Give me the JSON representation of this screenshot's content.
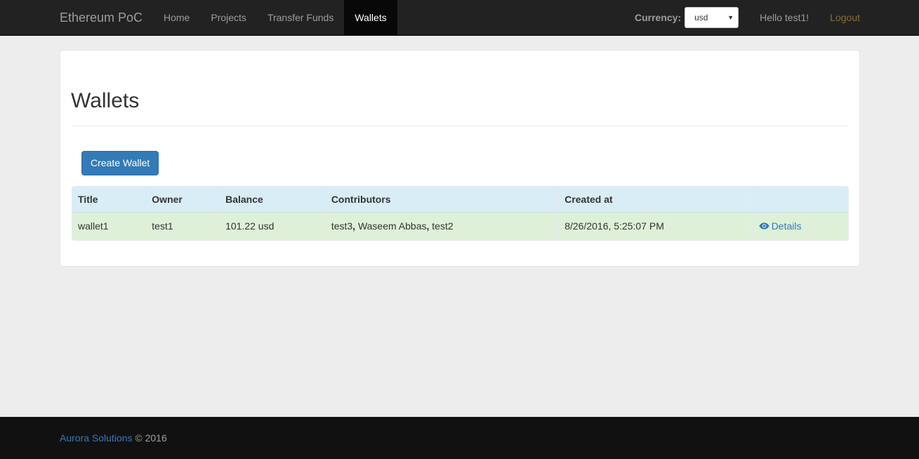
{
  "navbar": {
    "brand": "Ethereum PoC",
    "links": [
      {
        "label": "Home",
        "active": false
      },
      {
        "label": "Projects",
        "active": false
      },
      {
        "label": "Transfer Funds",
        "active": false
      },
      {
        "label": "Wallets",
        "active": true
      }
    ],
    "currency_label": "Currency:",
    "currency_value": "usd",
    "greeting": "Hello test1!",
    "logout_label": "Logout"
  },
  "main": {
    "title": "Wallets",
    "create_button": "Create Wallet",
    "table": {
      "headers": [
        "Title",
        "Owner",
        "Balance",
        "Contributors",
        "Created at",
        ""
      ],
      "rows": [
        {
          "title": "wallet1",
          "owner": "test1",
          "balance": "101.22 usd",
          "contributors": [
            "test3",
            "Waseem Abbas",
            "test2"
          ],
          "created_at": "8/26/2016, 5:25:07 PM",
          "action_label": "Details"
        }
      ]
    }
  },
  "footer": {
    "company": "Aurora Solutions",
    "copyright": "© 2016"
  },
  "colors": {
    "navbar_bg": "#222222",
    "active_nav_bg": "#080808",
    "primary": "#337ab7",
    "header_row": "#d9edf7",
    "success_row": "#dff0d8",
    "logout": "#8a6d3b",
    "footer_bg": "#111111"
  },
  "icons": {
    "details": "eye-icon",
    "select": "caret-down-icon"
  }
}
